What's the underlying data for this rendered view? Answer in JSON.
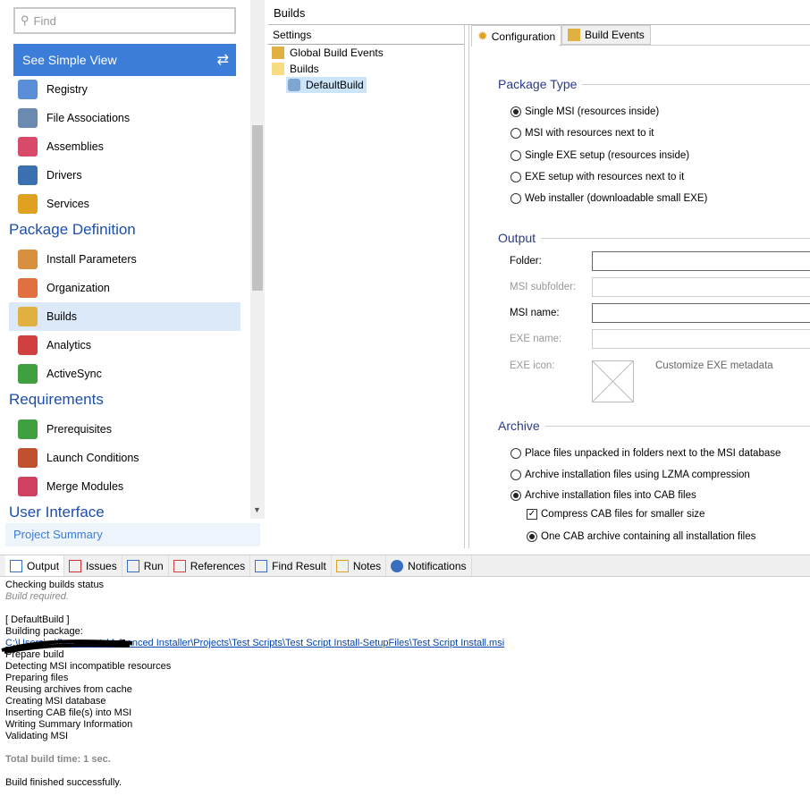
{
  "sidebar": {
    "search_placeholder": "Find",
    "simple_view": "See Simple View",
    "items_top": [
      {
        "label": "Registry",
        "color": "#5a8fd8"
      },
      {
        "label": "File Associations",
        "color": "#6a8ab0"
      },
      {
        "label": "Assemblies",
        "color": "#d84a6a"
      },
      {
        "label": "Drivers",
        "color": "#3a6fb0"
      },
      {
        "label": "Services",
        "color": "#e0a020"
      }
    ],
    "sections": [
      {
        "title": "Package Definition",
        "items": [
          {
            "label": "Install Parameters",
            "color": "#d89040"
          },
          {
            "label": "Organization",
            "color": "#e07040"
          },
          {
            "label": "Builds",
            "color": "#e0b040"
          },
          {
            "label": "Analytics",
            "color": "#d04040"
          },
          {
            "label": "ActiveSync",
            "color": "#40a040"
          }
        ]
      },
      {
        "title": "Requirements",
        "items": [
          {
            "label": "Prerequisites",
            "color": "#40a040"
          },
          {
            "label": "Launch Conditions",
            "color": "#c05030"
          },
          {
            "label": "Merge Modules",
            "color": "#d04060"
          }
        ]
      },
      {
        "title": "User Interface"
      }
    ],
    "selected": "Builds",
    "summary": "Project Summary"
  },
  "header": {
    "title": "Builds"
  },
  "tree": {
    "header": "Settings",
    "nodes": [
      "Global Build Events",
      "Builds",
      "DefaultBuild"
    ]
  },
  "tabs": [
    "Configuration",
    "Build Events"
  ],
  "package_type": {
    "title": "Package Type",
    "options": [
      "Single MSI (resources inside)",
      "MSI with resources next to it",
      "Single EXE setup (resources inside)",
      "EXE setup with resources next to it",
      "Web installer (downloadable small EXE)"
    ],
    "selected": 0
  },
  "output_group": {
    "title": "Output",
    "folder": "Folder:",
    "msi_subfolder": "MSI subfolder:",
    "msi_name": "MSI name:",
    "exe_name": "EXE name:",
    "exe_icon": "EXE icon:",
    "customize": "Customize EXE metadata"
  },
  "archive": {
    "title": "Archive",
    "options": [
      "Place files unpacked in folders next to the MSI database",
      "Archive installation files using LZMA compression",
      "Archive installation files into CAB files"
    ],
    "selected": 2,
    "compress": "Compress CAB files for smaller size",
    "compress_checked": true,
    "one_cab": "One CAB archive containing all installation files"
  },
  "bottom": {
    "tabs": [
      "Output",
      "Issues",
      "Run",
      "References",
      "Find Result",
      "Notes",
      "Notifications"
    ],
    "log": {
      "l1": "Checking builds status",
      "l2": "Build required.",
      "l3": "[ DefaultBuild ]",
      "l4": "Building package:",
      "path": "C:\\Users\\...\\Documents\\Advanced Installer\\Projects\\Test Scripts\\Test Script Install-SetupFiles\\Test Script Install.msi",
      "steps": [
        "Prepare build",
        "Detecting MSI incompatible resources",
        "Preparing files",
        "Reusing archives from cache",
        "Creating MSI database",
        "Inserting CAB file(s) into MSI",
        "Writing Summary Information",
        "Validating MSI"
      ],
      "time": "Total build time: 1 sec.",
      "done": "Build finished successfully."
    }
  }
}
